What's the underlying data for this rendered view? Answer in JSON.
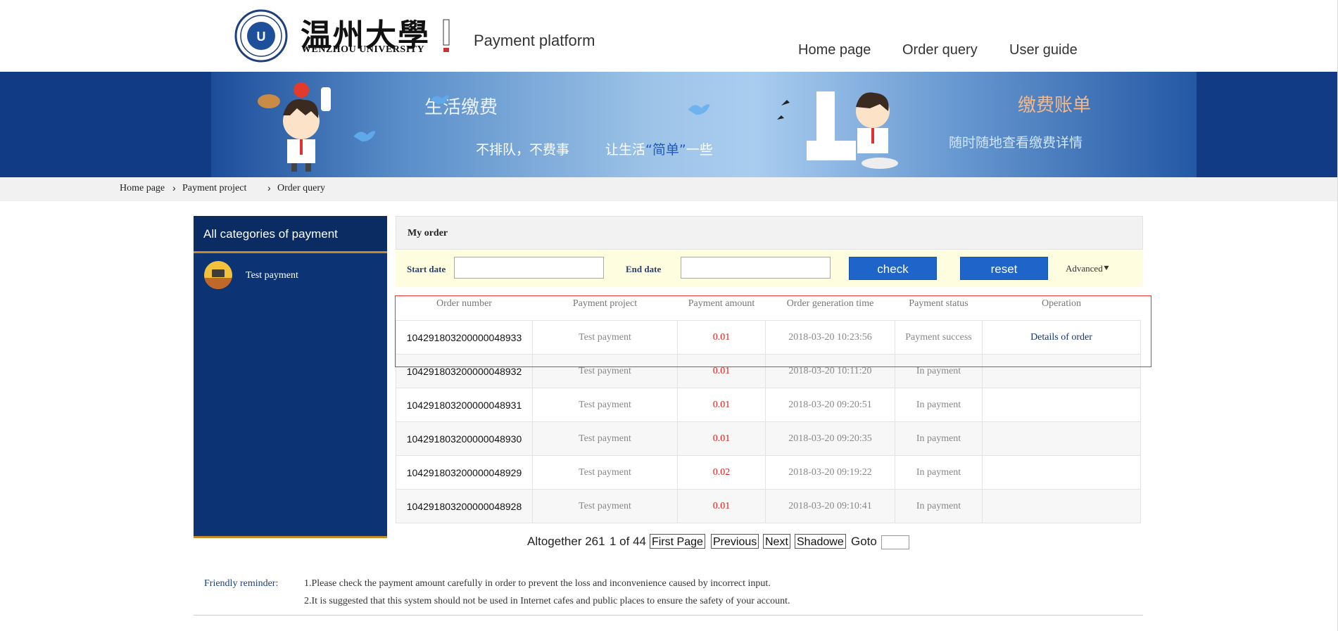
{
  "header": {
    "logo_cn": "温州大學",
    "logo_en": "WENZHOU UNIVERSITY",
    "platform_title": "Payment platform",
    "nav": [
      "Home page",
      "Order query",
      "User guide"
    ]
  },
  "banner": {
    "left_title": "生活缴费",
    "left_sub1": "不排队，不费事",
    "left_sub2": "让生活",
    "left_sub_highlight": "“简单”",
    "left_sub3": "一些",
    "right_title": "缴费账单",
    "right_sub": "随时随地查看缴费详情"
  },
  "breadcrumb": [
    "Home page",
    "Payment project",
    "Order query"
  ],
  "sidebar": {
    "title": "All categories of payment",
    "items": [
      {
        "label": "Test payment",
        "icon": "computer-icon"
      }
    ]
  },
  "panel": {
    "title": "My order",
    "filter": {
      "start_label": "Start date",
      "end_label": "End date",
      "check_label": "check",
      "reset_label": "reset",
      "advanced_label": "Advanced⯆",
      "start_value": "",
      "end_value": ""
    }
  },
  "table": {
    "columns": [
      "Order number",
      "Payment project",
      "Payment amount",
      "Order generation time",
      "Payment status",
      "Operation"
    ],
    "rows": [
      {
        "order": "104291803200000048933",
        "project": "Test payment",
        "amount": "0.01",
        "time": "2018-03-20 10:23:56",
        "status": "Payment success",
        "op": "Details of order"
      },
      {
        "order": "104291803200000048932",
        "project": "Test payment",
        "amount": "0.01",
        "time": "2018-03-20 10:11:20",
        "status": "In payment",
        "op": ""
      },
      {
        "order": "104291803200000048931",
        "project": "Test payment",
        "amount": "0.01",
        "time": "2018-03-20 09:20:51",
        "status": "In payment",
        "op": ""
      },
      {
        "order": "104291803200000048930",
        "project": "Test payment",
        "amount": "0.01",
        "time": "2018-03-20 09:20:35",
        "status": "In payment",
        "op": ""
      },
      {
        "order": "104291803200000048929",
        "project": "Test payment",
        "amount": "0.02",
        "time": "2018-03-20 09:19:22",
        "status": "In payment",
        "op": ""
      },
      {
        "order": "104291803200000048928",
        "project": "Test payment",
        "amount": "0.01",
        "time": "2018-03-20 09:10:41",
        "status": "In payment",
        "op": ""
      }
    ]
  },
  "pager": {
    "total_label": "Altogether 261",
    "page_label": "1 of 44",
    "first": "First Page",
    "prev": "Previous",
    "next": "Next",
    "last": "Shadowe",
    "goto_label": "Goto",
    "goto_value": ""
  },
  "reminder": {
    "label": "Friendly reminder:",
    "line1": "1.Please check the payment amount carefully in order to prevent the loss and inconvenience caused by incorrect input.",
    "line2": "2.It is suggested that this system should not be used in Internet cafes and public places to ensure the safety of your account."
  },
  "colors": {
    "brand_navy": "#0c3374",
    "button_blue": "#1f64c8",
    "amount_red": "#e41c1c",
    "highlight_border": "#e33"
  }
}
